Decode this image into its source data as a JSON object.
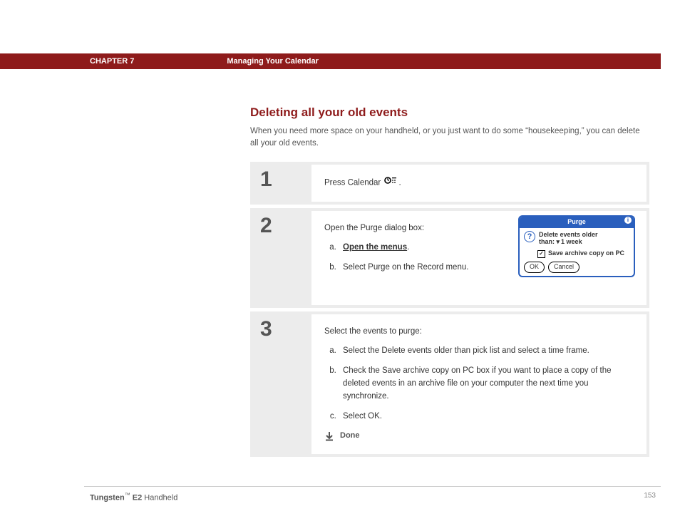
{
  "header": {
    "chapter_label": "CHAPTER 7",
    "chapter_title": "Managing Your Calendar"
  },
  "section": {
    "title": "Deleting all your old events",
    "intro": "When you need more space on your handheld, or you just want to do some “housekeeping,” you can delete all your old events."
  },
  "steps": [
    {
      "num": "1",
      "lead": "Press Calendar ",
      "trail": "."
    },
    {
      "num": "2",
      "lead": "Open the Purge dialog box:",
      "items": [
        {
          "text": "Open the menus",
          "suffix": ".",
          "bold_underline": true
        },
        {
          "text": "Select Purge on the Record menu."
        }
      ]
    },
    {
      "num": "3",
      "lead": "Select the events to purge:",
      "items": [
        {
          "text": "Select the Delete events older than pick list and select a time frame."
        },
        {
          "text": "Check the Save archive copy on PC box if you want to place a copy of the deleted events in an archive file on your computer the next time you synchronize."
        },
        {
          "text": "Select OK."
        }
      ],
      "done": "Done"
    }
  ],
  "purge_dialog": {
    "title": "Purge",
    "info": "i",
    "question": "?",
    "line1": "Delete events older",
    "line2_prefix": "than:",
    "dropdown_value": "1 week",
    "checkbox_label": "Save archive copy on PC",
    "check_mark": "✓",
    "ok": "OK",
    "cancel": "Cancel"
  },
  "footer": {
    "product_bold": "Tungsten",
    "tm": "™",
    "product_rest": " E2",
    "product_tail": " Handheld",
    "page": "153"
  }
}
